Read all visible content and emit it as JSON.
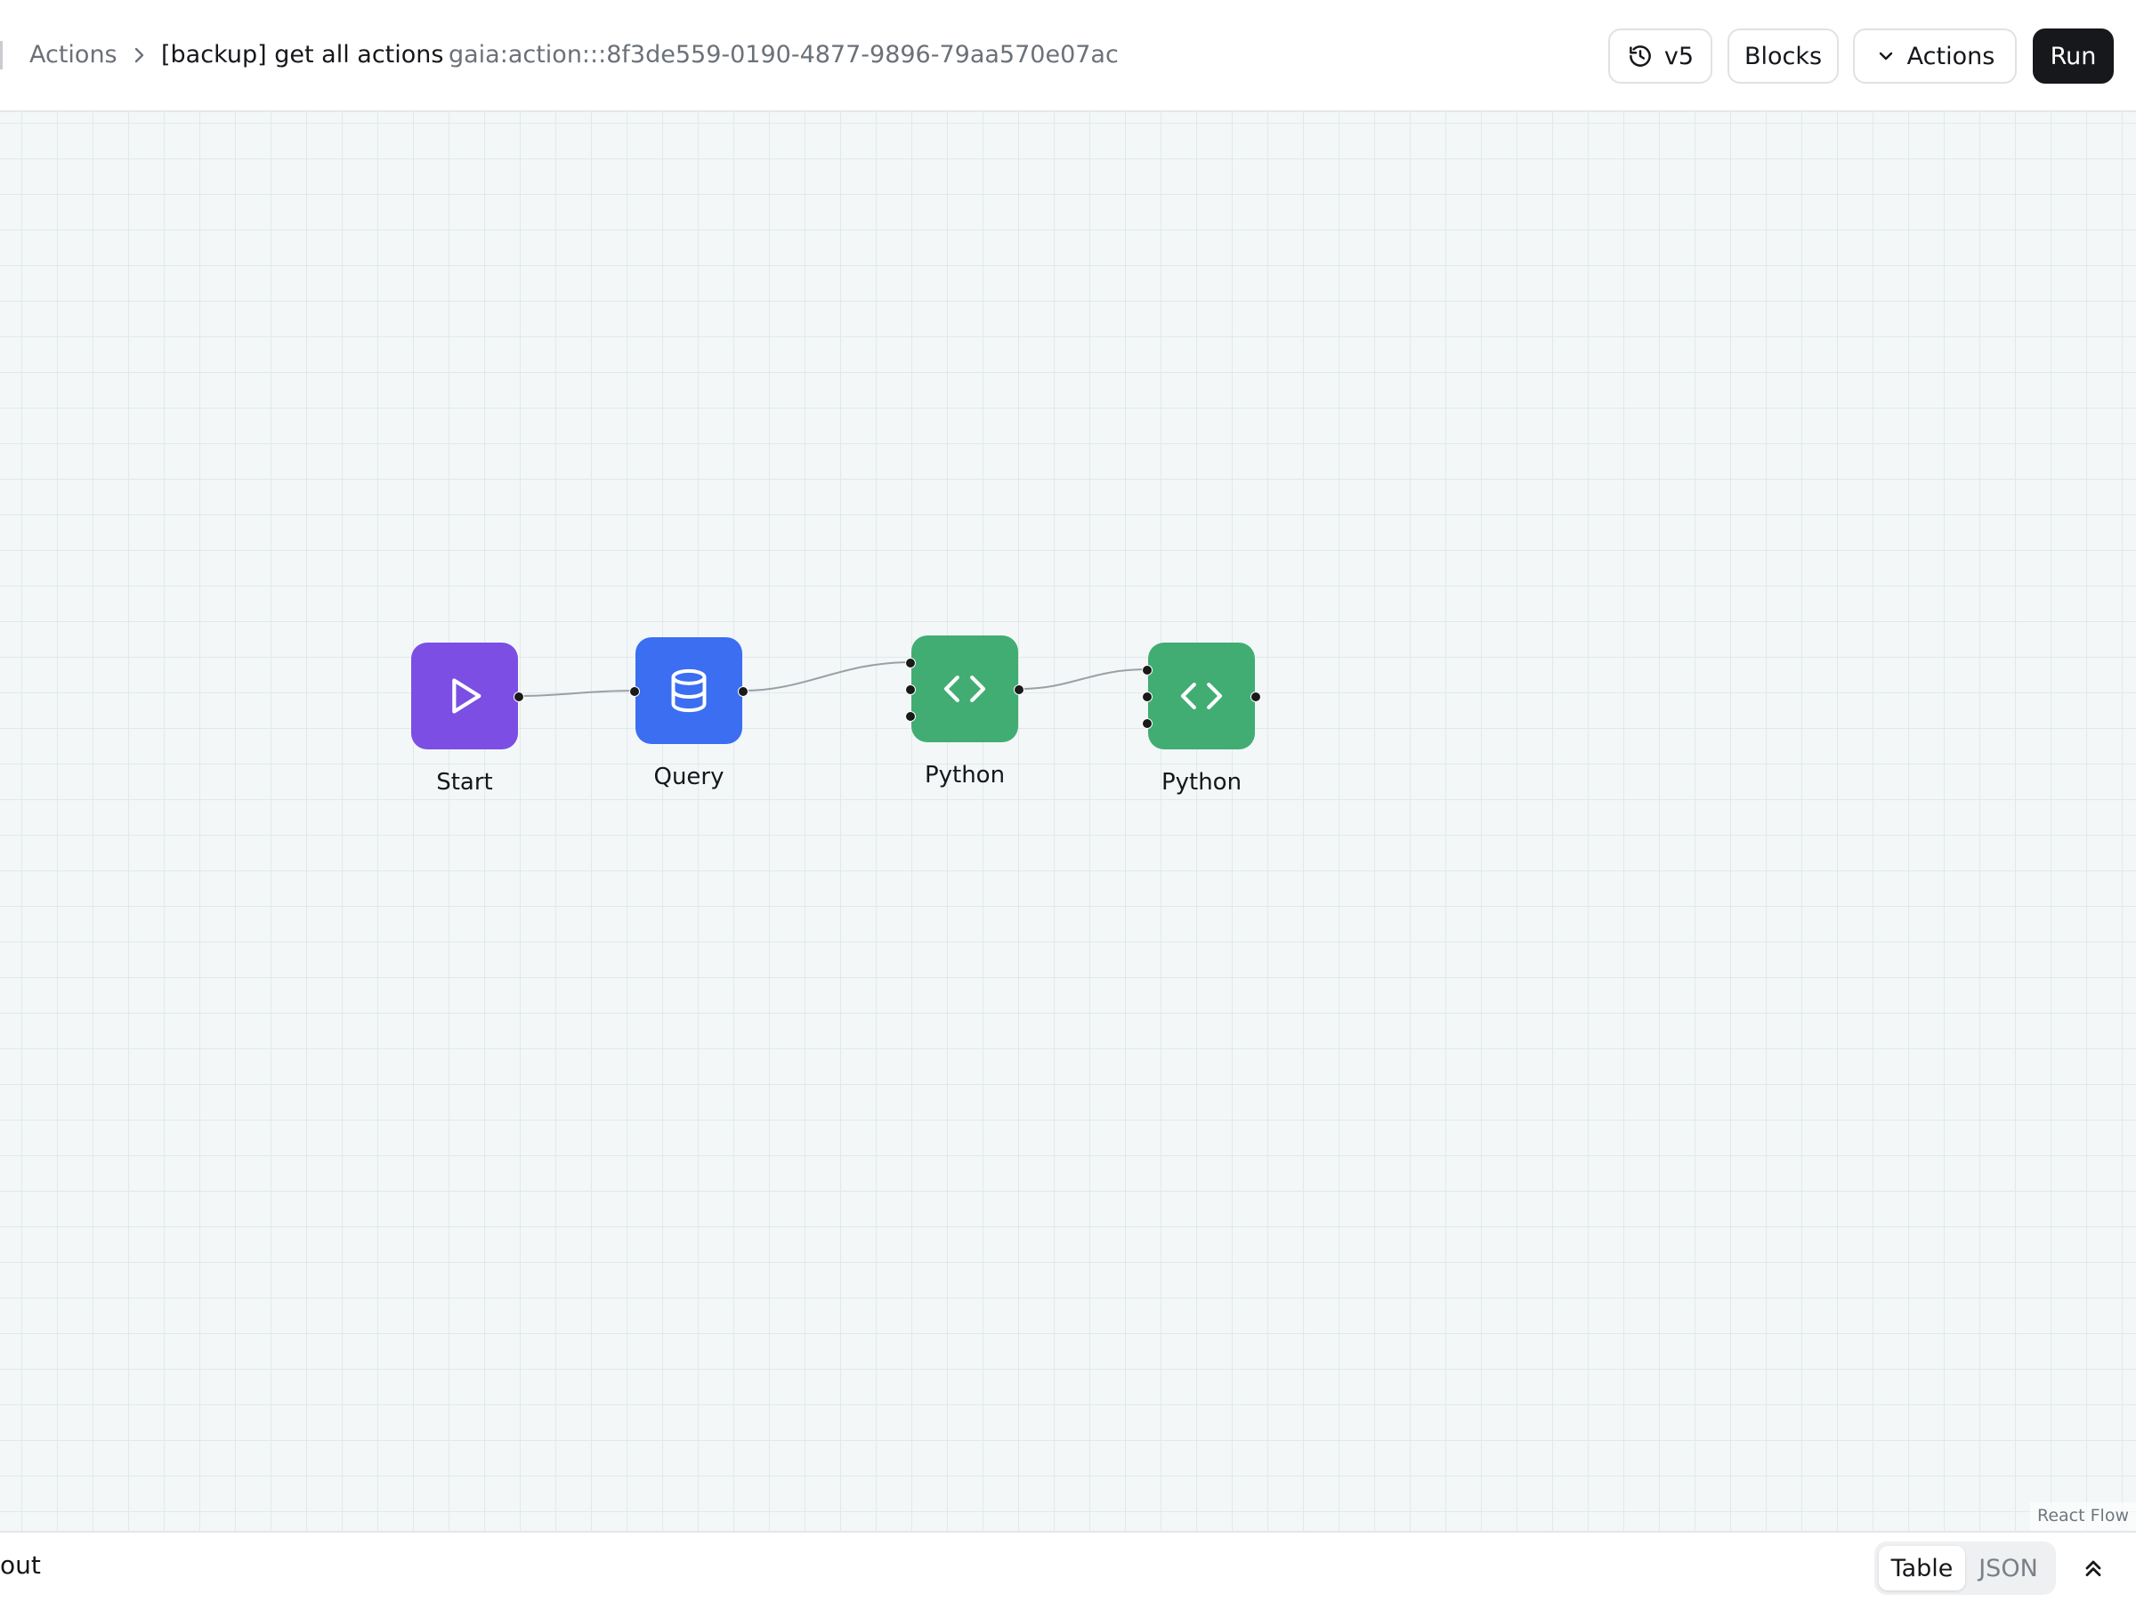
{
  "header": {
    "breadcrumb_root": "Actions",
    "action_title": "[backup] get all actions",
    "action_id": "gaia:action:::8f3de559-0190-4877-9896-79aa570e07ac",
    "version_label": "v5",
    "blocks_label": "Blocks",
    "actions_menu_label": "Actions",
    "run_label": "Run"
  },
  "flow": {
    "nodes": [
      {
        "label": "Start",
        "icon": "play-icon",
        "color": "#7c4ee4"
      },
      {
        "label": "Query",
        "icon": "database-icon",
        "color": "#3b6ef0"
      },
      {
        "label": "Python",
        "icon": "code-icon",
        "color": "#41ad72"
      },
      {
        "label": "Python",
        "icon": "code-icon",
        "color": "#41ad72"
      }
    ],
    "attribution": "React Flow"
  },
  "bottom_panel": {
    "title": "out",
    "tabs": [
      "Table",
      "JSON"
    ],
    "active_tab": "Table"
  }
}
